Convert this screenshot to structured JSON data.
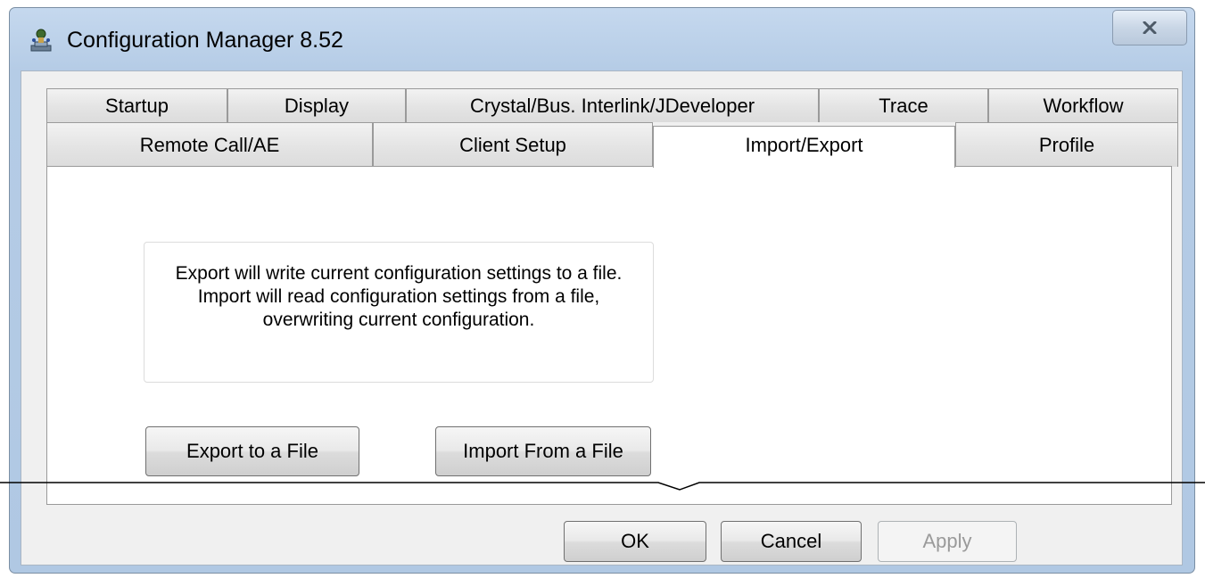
{
  "window": {
    "title": "Configuration Manager 8.52",
    "app_icon": "config-manager-icon",
    "close_icon": "close-icon"
  },
  "tabs": {
    "row_top": [
      {
        "label": "Startup"
      },
      {
        "label": "Display"
      },
      {
        "label": "Crystal/Bus. Interlink/JDeveloper"
      },
      {
        "label": "Trace"
      },
      {
        "label": "Workflow"
      }
    ],
    "row_bottom": [
      {
        "label": "Remote Call/AE"
      },
      {
        "label": "Client Setup"
      },
      {
        "label": "Import/Export",
        "selected": true
      },
      {
        "label": "Profile"
      }
    ]
  },
  "import_export": {
    "info_text": "Export will write current configuration settings to a file. Import will read configuration settings from a file, overwriting current configuration.",
    "export_label": "Export to a File",
    "import_label": "Import From a File"
  },
  "footer": {
    "ok_label": "OK",
    "cancel_label": "Cancel",
    "apply_label": "Apply",
    "apply_enabled": false
  },
  "colors": {
    "title_bar": "#c5d8ee",
    "tab_active": "#ffffff",
    "tab_inactive": "#e4e4e4",
    "client_bg": "#f0f0f0",
    "disabled_text": "#9a9a9a"
  }
}
